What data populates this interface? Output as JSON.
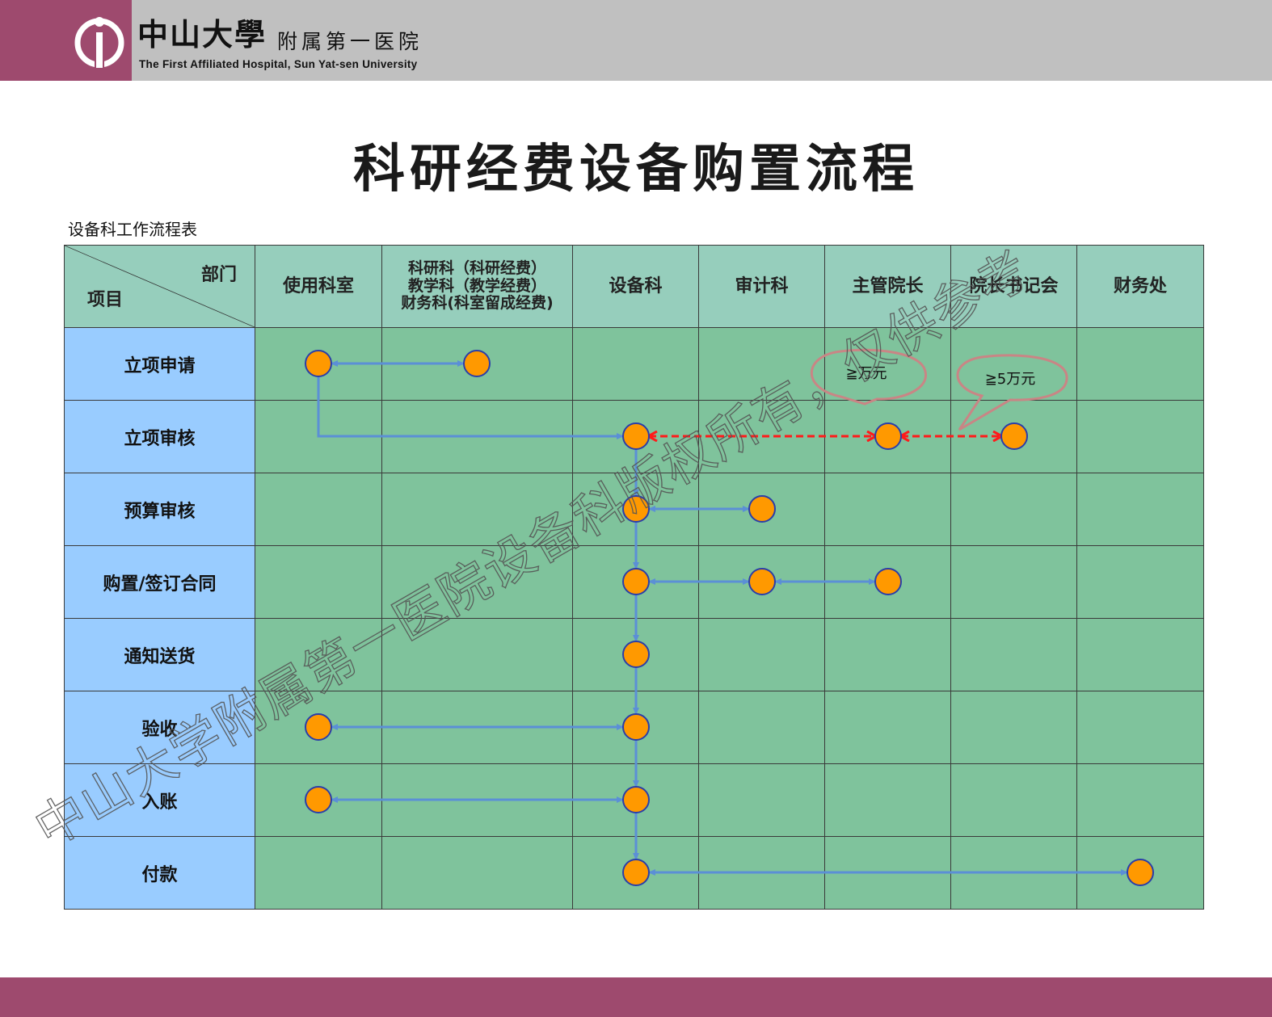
{
  "header": {
    "logo_cn": "中山大學",
    "logo_cn_sub": "附属第一医院",
    "logo_en": "The First Affiliated Hospital, Sun Yat-sen University"
  },
  "title": "科研经费设备购置流程",
  "caption": "设备科工作流程表",
  "table": {
    "corner_dept": "部门",
    "corner_item": "项目",
    "columns": [
      "使用科室",
      "科研科（科研经费）\n教学科（教学经费）\n财务科(科室留成经费)",
      "设备科",
      "审计科",
      "主管院长",
      "院长书记会",
      "财务处"
    ],
    "rows": [
      "立项申请",
      "立项审核",
      "预算审核",
      "购置/签订合同",
      "通知送货",
      "验收",
      "入账",
      "付款"
    ]
  },
  "annotations": {
    "bubble1": "≧万元",
    "bubble2": "≧5万元"
  },
  "watermark": "中山大学附属第一医院设备科版权所有，仅供参考",
  "colors": {
    "header_bg": "#c0c0c0",
    "brand": "#9e4a6e",
    "table_header": "#96cebc",
    "row_header": "#99ccff",
    "cell": "#7fc39c",
    "node_fill": "#ff9900",
    "node_stroke": "#2b3ea8",
    "arrow_blue": "#5b8fd6",
    "arrow_red": "#ff1a1a"
  }
}
